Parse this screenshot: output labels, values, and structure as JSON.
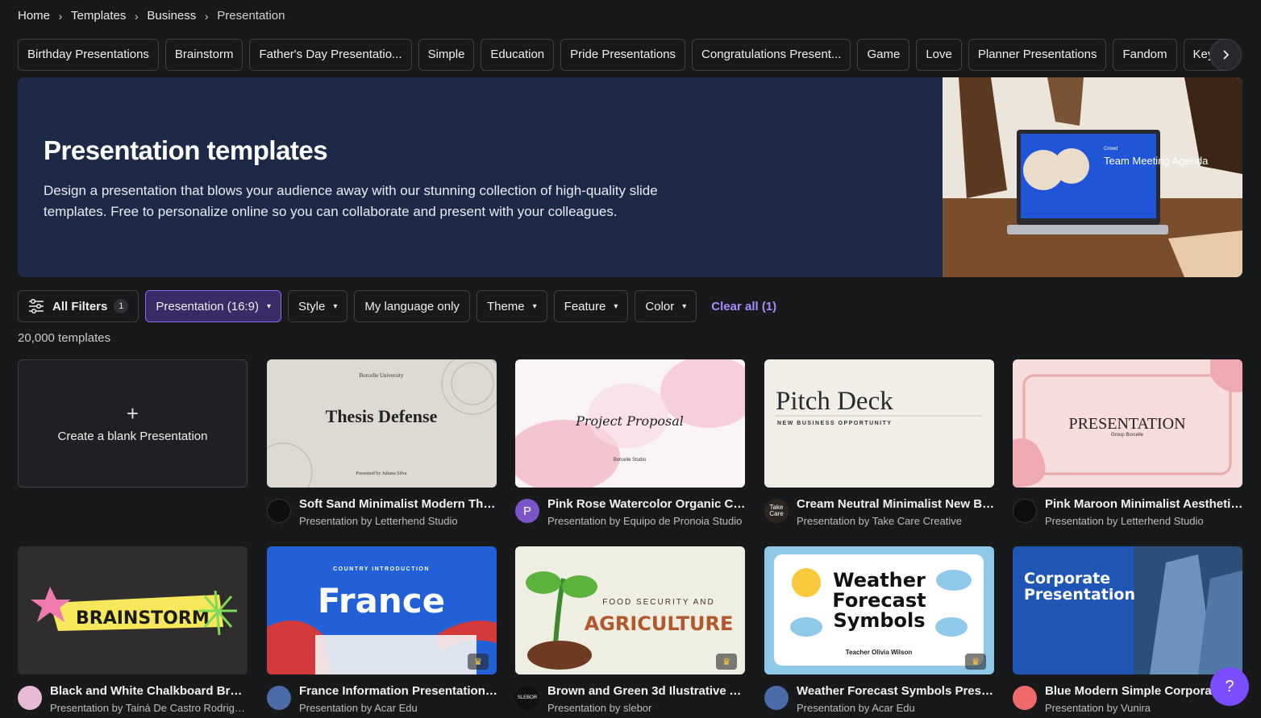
{
  "breadcrumb": {
    "items": [
      "Home",
      "Templates",
      "Business",
      "Presentation"
    ]
  },
  "chips": [
    "Birthday Presentations",
    "Brainstorm",
    "Father's Day Presentatio...",
    "Simple",
    "Education",
    "Pride Presentations",
    "Congratulations Present...",
    "Game",
    "Love",
    "Planner Presentations",
    "Fandom",
    "Keyn"
  ],
  "hero": {
    "title": "Presentation templates",
    "description": "Design a presentation that blows your audience away with our stunning collection of high-quality slide templates. Free to personalize online so you can collaborate and present with your colleagues.",
    "image_slide_text": {
      "brand": "Crowd",
      "title": "Team Meeting Agenda"
    }
  },
  "filters": {
    "all_filters": "All Filters",
    "all_filters_count": "1",
    "presentation": "Presentation (16:9)",
    "style": "Style",
    "language": "My language only",
    "theme": "Theme",
    "feature": "Feature",
    "color": "Color",
    "clear": "Clear all (1)"
  },
  "count": "20,000 templates",
  "blank_card": {
    "label": "Create a blank Presentation"
  },
  "cards": [
    {
      "title": "Soft Sand Minimalist Modern Thes...",
      "author": "Presentation by Letterhend Studio",
      "thumb_text": {
        "top": "Borcelle University",
        "main": "Thesis Defense",
        "bottom": "Presented by Juliana Silva"
      }
    },
    {
      "title": "Pink Rose Watercolor Organic Cre...",
      "author": "Presentation by Equipo de Pronoia Studio",
      "avatar_letter": "P",
      "thumb_text": {
        "main": "Project Proposal",
        "bottom": "Borcelle Studio"
      }
    },
    {
      "title": "Cream Neutral Minimalist New Bu...",
      "author": "Presentation by Take Care Creative",
      "avatar_text": "Take Care",
      "thumb_text": {
        "main": "Pitch Deck",
        "sub": "NEW BUSINESS OPPORTUNITY"
      }
    },
    {
      "title": "Pink Maroon Minimalist Aesthetic ...",
      "author": "Presentation by Letterhend Studio",
      "thumb_text": {
        "main": "PRESENTATION",
        "sub": "Group Borcelle"
      }
    },
    {
      "title": "Black and White Chalkboard Brain...",
      "author": "Presentation by Tainá De Castro Rodrigu...",
      "thumb_text": {
        "main": "BRAINSTORM"
      }
    },
    {
      "title": "France Information Presentation ...",
      "author": "Presentation by Acar Edu",
      "thumb_text": {
        "top": "COUNTRY INTRODUCTION",
        "main": "France"
      }
    },
    {
      "title": "Brown and Green 3d Ilustrative Ag...",
      "author": "Presentation by slebor",
      "avatar_text": "SLEBOR",
      "thumb_text": {
        "top": "FOOD SECURITY AND",
        "main": "AGRICULTURE"
      }
    },
    {
      "title": "Weather Forecast Symbols Presen...",
      "author": "Presentation by Acar Edu",
      "thumb_text": {
        "main": "Weather Forecast Symbols",
        "bottom": "Teacher Olivia Wilson"
      }
    },
    {
      "title": "Blue Modern Simple Corporate ...",
      "author": "Presentation by Vunira",
      "thumb_text": {
        "main": "Corporate Presentation"
      }
    }
  ],
  "help": {
    "label": "?"
  }
}
